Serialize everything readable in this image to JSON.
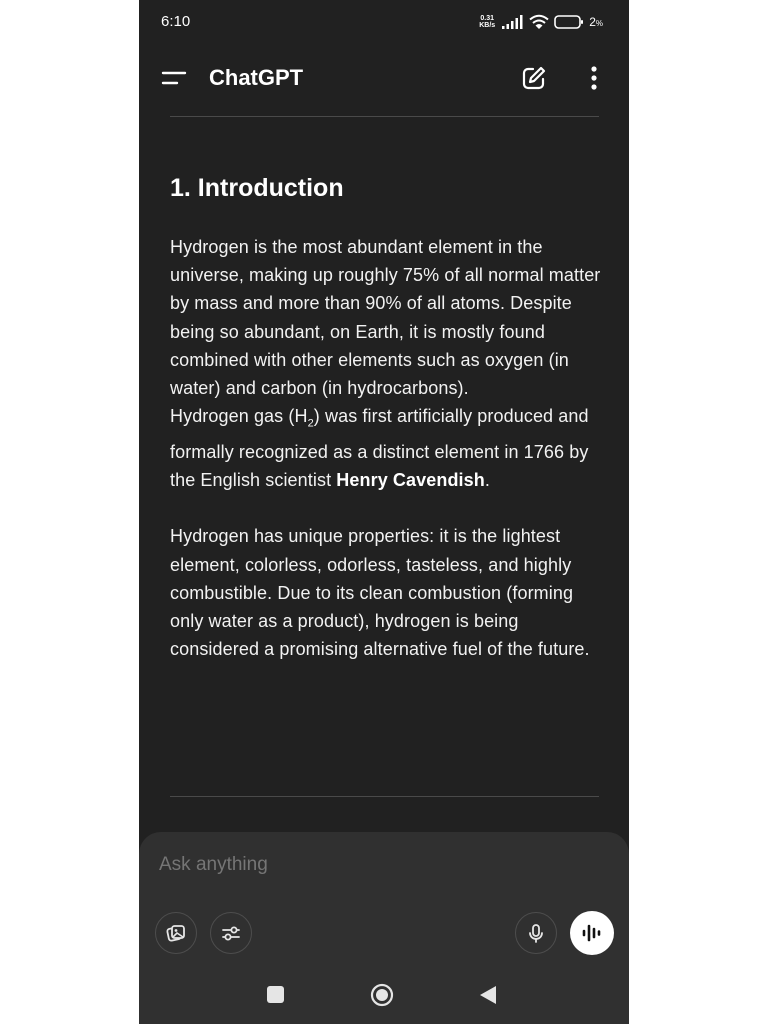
{
  "status_bar": {
    "time": "6:10",
    "net_speed_value": "0.31",
    "net_speed_unit": "KB/s",
    "battery_percent": "2",
    "battery_unit": "%"
  },
  "header": {
    "title": "ChatGPT"
  },
  "message": {
    "section_title": "1. Introduction",
    "para1": "Hydrogen is the most abundant element in the universe, making up roughly 75% of all normal matter by mass and more than 90% of all atoms. Despite being so abundant, on Earth, it is mostly found combined with other elements such as oxygen (in water) and carbon (in hydrocarbons).",
    "para2_before": "Hydrogen gas (H",
    "para2_sub": "2",
    "para2_middle": ") was first artificially produced and formally recognized as a distinct element in 1766 by the English scientist ",
    "para2_bold": "Henry Cavendish",
    "para2_end": ".",
    "para3": "Hydrogen has unique properties: it is the lightest element, colorless, odorless, tasteless, and highly combustible. Due to its clean combustion (forming only water as a product), hydrogen is being considered a promising alternative fuel of the future."
  },
  "composer": {
    "placeholder": "Ask anything"
  },
  "icons": {
    "menu": "menu-icon",
    "new_chat": "edit-icon",
    "more": "more-vertical-icon",
    "photos": "photos-icon",
    "tools": "sliders-icon",
    "mic": "mic-icon",
    "voice": "voice-waveform-icon",
    "nav_recents": "square-icon",
    "nav_home": "circle-icon",
    "nav_back": "triangle-back-icon"
  },
  "colors": {
    "background": "#212121",
    "composer": "#303030",
    "text": "#f2f2f2",
    "accent": "#ffffff"
  }
}
